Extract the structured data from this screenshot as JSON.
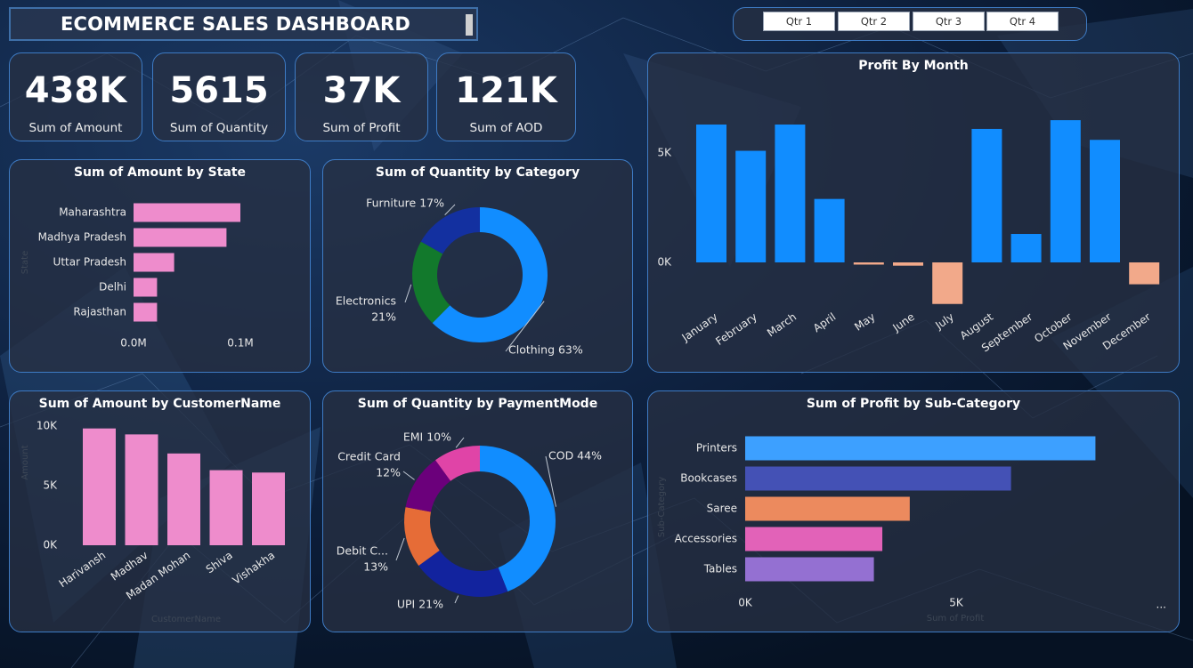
{
  "header": {
    "title": "ECOMMERCE SALES DASHBOARD"
  },
  "slicer": {
    "items": [
      "Qtr 1",
      "Qtr 2",
      "Qtr 3",
      "Qtr 4"
    ]
  },
  "kpis": [
    {
      "value": "438K",
      "label": "Sum of Amount"
    },
    {
      "value": "5615",
      "label": "Sum of Quantity"
    },
    {
      "value": "37K",
      "label": "Sum of Profit"
    },
    {
      "value": "121K",
      "label": "Sum of AOD"
    }
  ],
  "colors": {
    "pink": "#ee8ccc",
    "blue": "#118dff",
    "salmon": "#f2a98a",
    "panel_border": "#3e7bc4"
  },
  "chart_data": [
    {
      "id": "amount_by_state",
      "type": "bar",
      "orientation": "horizontal",
      "title": "Sum of Amount by State",
      "ylabel": "State",
      "categories": [
        "Maharashtra",
        "Madhya Pradesh",
        "Uttar Pradesh",
        "Delhi",
        "Rajasthan"
      ],
      "values": [
        0.1,
        0.087,
        0.038,
        0.022,
        0.022
      ],
      "xticks": [
        "0.0M",
        "0.1M"
      ],
      "xlim": [
        0,
        0.1
      ],
      "color": "#ee8ccc"
    },
    {
      "id": "quantity_by_category",
      "type": "pie",
      "donut": true,
      "title": "Sum of Quantity by Category",
      "labels": [
        "Clothing",
        "Electronics",
        "Furniture"
      ],
      "values": [
        63,
        21,
        17
      ],
      "display_labels": [
        "Clothing 63%",
        "Electronics\n21%",
        "Furniture 17%"
      ],
      "colors": [
        "#118dff",
        "#12792c",
        "#1330a0"
      ]
    },
    {
      "id": "profit_by_month",
      "type": "bar",
      "title": "Profit By Month",
      "categories": [
        "January",
        "February",
        "March",
        "April",
        "May",
        "June",
        "July",
        "August",
        "September",
        "October",
        "November",
        "December"
      ],
      "values": [
        6300,
        5100,
        6300,
        2900,
        -100,
        -150,
        -1900,
        6100,
        1300,
        6500,
        5600,
        -1000
      ],
      "yticks": [
        "5K",
        "0K"
      ],
      "ylim": [
        -2400,
        8300
      ],
      "positive_color": "#118dff",
      "negative_color": "#f2a98a"
    },
    {
      "id": "amount_by_customer",
      "type": "bar",
      "title": "Sum of Amount by CustomerName",
      "xlabel": "CustomerName",
      "ylabel": "Amount",
      "categories": [
        "Harivansh",
        "Madhav",
        "Madan Mohan",
        "Shiva",
        "Vishakha"
      ],
      "values": [
        9800,
        9300,
        7700,
        6300,
        6100
      ],
      "yticks": [
        "10K",
        "5K",
        "0K"
      ],
      "ylim": [
        0,
        10000
      ],
      "color": "#ee8ccc"
    },
    {
      "id": "quantity_by_paymentmode",
      "type": "pie",
      "donut": true,
      "title": "Sum of Quantity by PaymentMode",
      "labels": [
        "COD",
        "UPI",
        "Debit Card",
        "Credit Card",
        "EMI"
      ],
      "values": [
        44,
        21,
        13,
        12,
        10
      ],
      "display_labels": [
        "COD 44%",
        "UPI 21%",
        "Debit C...\n13%",
        "Credit Card\n12%",
        "EMI 10%"
      ],
      "colors": [
        "#118dff",
        "#12239e",
        "#e66c37",
        "#6b007b",
        "#e044a7"
      ]
    },
    {
      "id": "profit_by_subcategory",
      "type": "bar",
      "orientation": "horizontal",
      "title": "Sum of Profit by Sub-Category",
      "xlabel": "Sum of Profit",
      "ylabel": "Sub-Category",
      "categories": [
        "Printers",
        "Bookcases",
        "Saree",
        "Accessories",
        "Tables"
      ],
      "values": [
        8300,
        6300,
        3900,
        3250,
        3050
      ],
      "xticks": [
        "0K",
        "5K"
      ],
      "xlim": [
        0,
        5000
      ],
      "colors": [
        "#3da0ff",
        "#4451b5",
        "#ec8a5e",
        "#e262b8",
        "#9470d2"
      ],
      "more_label": "..."
    }
  ]
}
